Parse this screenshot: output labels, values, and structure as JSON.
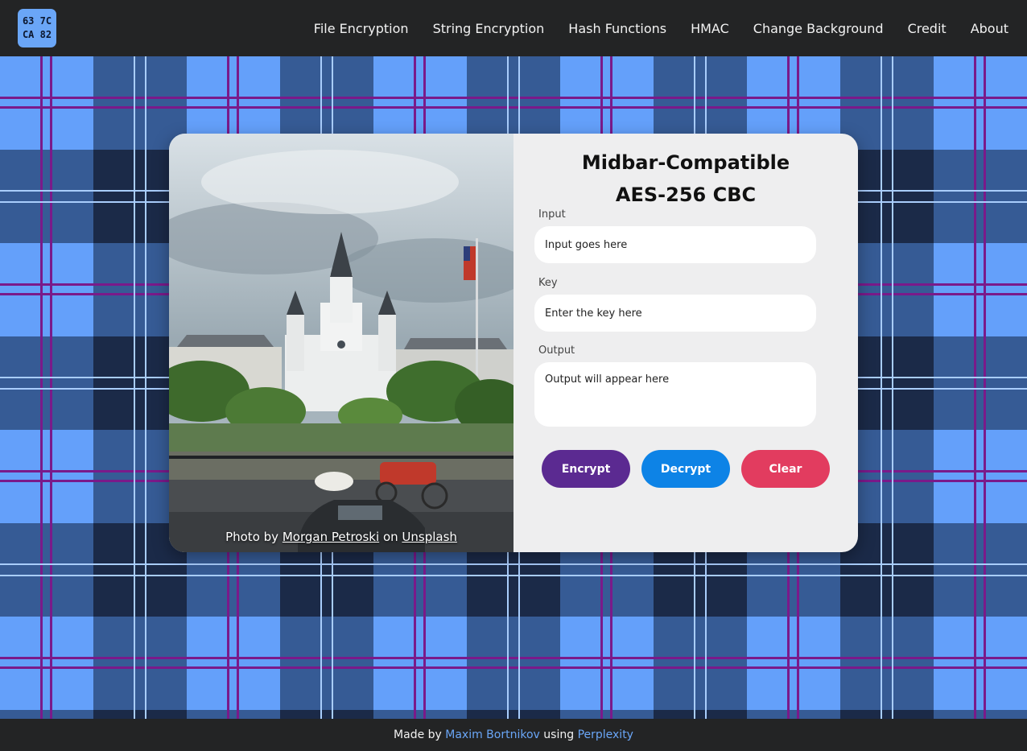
{
  "logo": {
    "line1": "63 7C",
    "line2": "CA 82"
  },
  "nav": {
    "items": [
      {
        "label": "File Encryption"
      },
      {
        "label": "String Encryption"
      },
      {
        "label": "Hash Functions"
      },
      {
        "label": "HMAC"
      },
      {
        "label": "Change Background"
      },
      {
        "label": "Credit"
      },
      {
        "label": "About"
      }
    ]
  },
  "card": {
    "photo_credit": {
      "prefix": "Photo by",
      "author": "Morgan Petroski",
      "on": "on",
      "site": "Unsplash"
    },
    "title_line1": "Midbar-Compatible",
    "title_line2": "AES-256 CBC",
    "input": {
      "label": "Input",
      "placeholder": "Input goes here"
    },
    "key": {
      "label": "Key",
      "placeholder": "Enter the key here"
    },
    "output": {
      "label": "Output",
      "placeholder": "Output will appear here"
    },
    "buttons": {
      "encrypt": "Encrypt",
      "decrypt": "Decrypt",
      "clear": "Clear"
    }
  },
  "footer": {
    "made_by": "Made by",
    "author": "Maxim Bortnikov",
    "using": "using",
    "tool": "Perplexity"
  },
  "colors": {
    "navbar_bg": "#232425",
    "plaid_light": "#64a0fa",
    "plaid_dark": "#31538a",
    "plaid_darkest": "#1b2a48",
    "plaid_stripe_purple": "#7a1a8a",
    "encrypt": "#5b2a91",
    "decrypt": "#0d83e6",
    "clear": "#e23c5f",
    "link": "#6aa6f7"
  }
}
